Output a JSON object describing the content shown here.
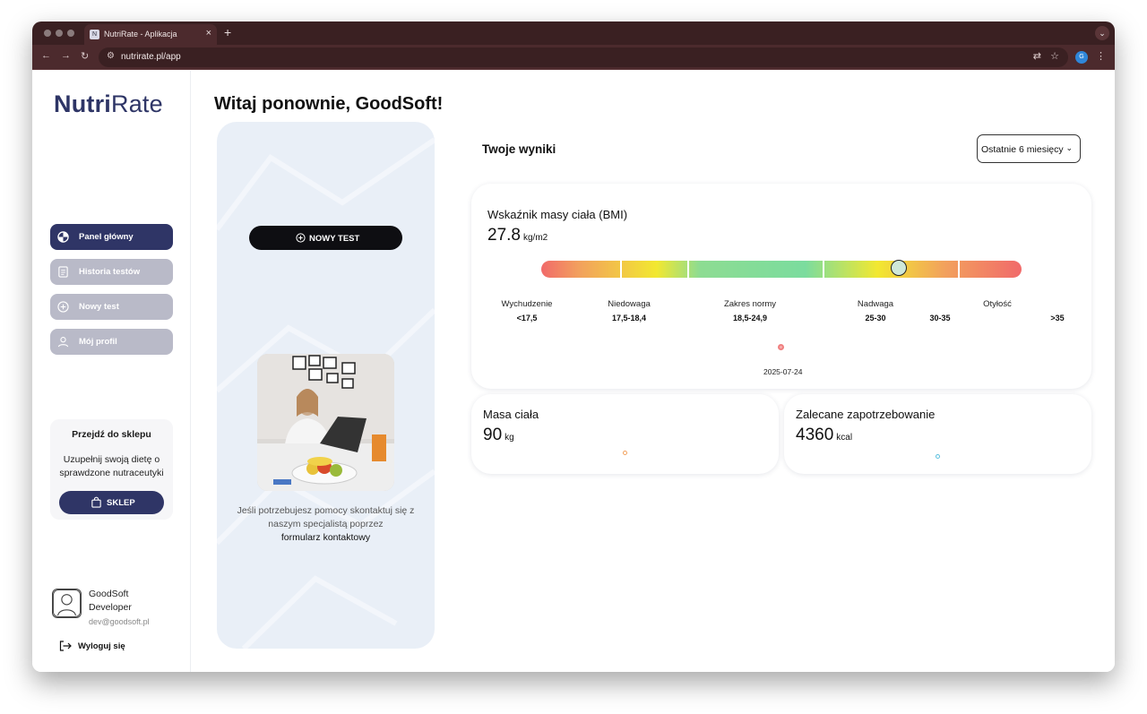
{
  "browser": {
    "tab_title": "NutriRate - Aplikacja",
    "url": "nutrirate.pl/app",
    "profile_initial": "G"
  },
  "sidebar": {
    "logo_bold": "Nutri",
    "logo_light": "Rate",
    "items": [
      {
        "label": "Panel główny",
        "icon": "pie-chart-icon",
        "active": true
      },
      {
        "label": "Historia testów",
        "icon": "document-icon",
        "active": false
      },
      {
        "label": "Nowy test",
        "icon": "plus-circle-icon",
        "active": false
      },
      {
        "label": "Mój profil",
        "icon": "user-icon",
        "active": false
      }
    ],
    "shop": {
      "title": "Przejdź do sklepu",
      "description": "Uzupełnij swoją dietę o sprawdzone nutraceutyki",
      "button": "SKLEP"
    },
    "user": {
      "first_name": "GoodSoft",
      "last_name": "Developer",
      "email": "dev@goodsoft.pl"
    },
    "logout": "Wyloguj się"
  },
  "main": {
    "greeting": "Witaj ponownie, GoodSoft!",
    "promo": {
      "new_test_button": "NOWY TEST",
      "help_text": "Jeśli potrzebujesz pomocy skontaktuj się z naszym specjalistą poprzez",
      "help_link": "formularz kontaktowy"
    },
    "results_title": "Twoje wyniki",
    "range_select": "Ostatnie 6 miesięcy",
    "bmi": {
      "title": "Wskaźnik masy ciała (BMI)",
      "value": "27.8",
      "unit": "kg/m2",
      "value_numeric": 27.8,
      "categories": [
        {
          "label": "Wychudzenie",
          "range": "<17,5"
        },
        {
          "label": "Niedowaga",
          "range": "17,5-18,4"
        },
        {
          "label": "Zakres normy",
          "range": "18,5-24,9"
        },
        {
          "label": "Nadwaga",
          "range": "25-30"
        },
        {
          "label": "",
          "range": "30-35"
        },
        {
          "label": "Otyłość",
          "range": ">35"
        }
      ],
      "history_date": "2025-07-24",
      "colors": {
        "low": "#f16a6a",
        "mid": "#7bdc9e",
        "warn": "#f2e830"
      }
    },
    "weight": {
      "title": "Masa ciała",
      "value": "90",
      "unit": "kg",
      "dot_color": "#f2a15d"
    },
    "energy": {
      "title": "Zalecane zapotrzebowanie",
      "value": "4360",
      "unit": "kcal",
      "dot_color": "#5bc0de"
    }
  },
  "colors": {
    "brand": "#2f3566",
    "nav_inactive": "#b9bac8",
    "promo_bg": "#e9eff7"
  }
}
